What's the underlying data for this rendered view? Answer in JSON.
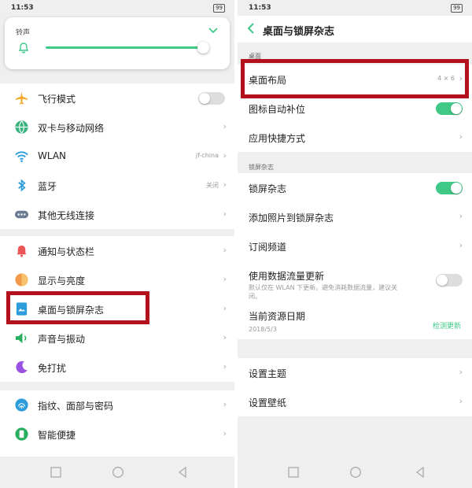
{
  "status": {
    "time": "11:53",
    "battery": "99"
  },
  "left": {
    "ringtone_label": "铃声",
    "group1": [
      {
        "label": "飞行模式",
        "icon": "airplane-icon",
        "toggle": "off"
      },
      {
        "label": "双卡与移动网络",
        "icon": "sim-globe-icon"
      },
      {
        "label": "WLAN",
        "icon": "wifi-icon",
        "value": "jf-china"
      },
      {
        "label": "蓝牙",
        "icon": "bluetooth-icon",
        "value": "关闭"
      },
      {
        "label": "其他无线连接",
        "icon": "more-dots-icon"
      }
    ],
    "group2": [
      {
        "label": "通知与状态栏",
        "icon": "bell-icon"
      },
      {
        "label": "显示与亮度",
        "icon": "brightness-icon"
      },
      {
        "label": "桌面与锁屏杂志",
        "icon": "desktop-icon"
      },
      {
        "label": "声音与振动",
        "icon": "speaker-icon"
      },
      {
        "label": "免打扰",
        "icon": "moon-icon"
      }
    ],
    "group3": [
      {
        "label": "指纹、面部与密码",
        "icon": "fingerprint-icon"
      },
      {
        "label": "智能便捷",
        "icon": "smart-icon"
      }
    ]
  },
  "right": {
    "title": "桌面与锁屏杂志",
    "section1": "桌面",
    "layout_label": "桌面布局",
    "layout_value": "4 × 6",
    "auto_fill_label": "图标自动补位",
    "shortcuts_label": "应用快捷方式",
    "section2": "锁屏杂志",
    "magazine_label": "锁屏杂志",
    "add_photos_label": "添加照片到锁屏杂志",
    "subscribe_label": "订阅频道",
    "data_update_label": "使用数据流量更新",
    "data_update_desc_1": "默认仅在 WLAN 下更新。避免消耗数据流量，建议关",
    "data_update_desc_2": "闭。",
    "resource_date_label": "当前资源日期",
    "resource_date_value": "2018/5/3",
    "check_update_label": "检测更新",
    "theme_label": "设置主题",
    "wallpaper_label": "设置壁纸"
  },
  "colors": {
    "accent": "#3fc886",
    "highlight": "#b3111b",
    "background": "#efefef"
  }
}
